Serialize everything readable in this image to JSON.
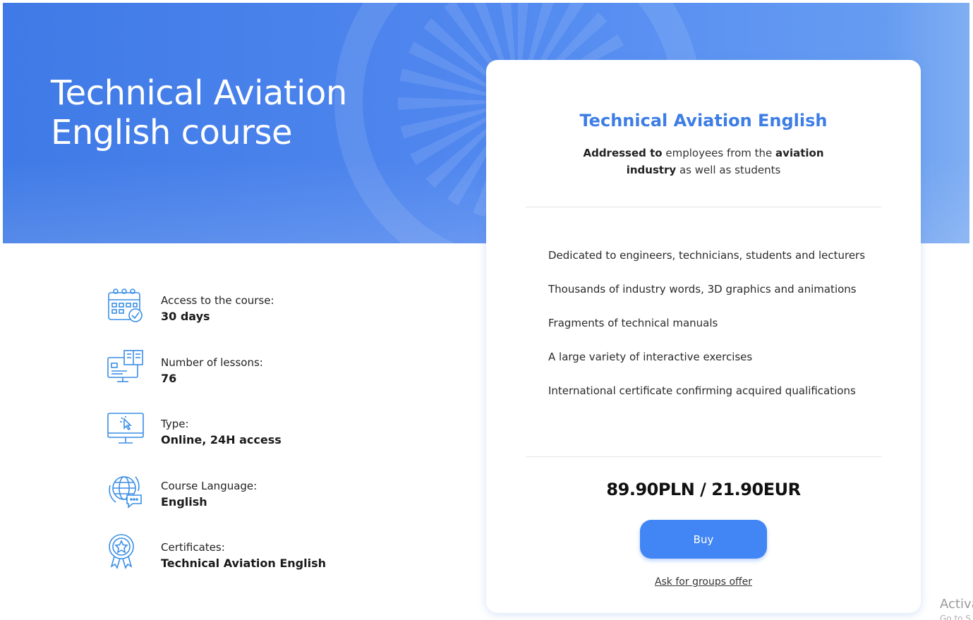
{
  "hero": {
    "title_line1": "Technical Aviation",
    "title_line2": "English course"
  },
  "features": [
    {
      "icon": "calendar-check-icon",
      "label": "Access to the course:",
      "value": "30 days"
    },
    {
      "icon": "lessons-screen-icon",
      "label": "Number of lessons:",
      "value": "76"
    },
    {
      "icon": "monitor-cursor-icon",
      "label": "Type:",
      "value": "Online, 24H access"
    },
    {
      "icon": "globe-chat-icon",
      "label": "Course Language:",
      "value": "English"
    },
    {
      "icon": "certificate-badge-icon",
      "label": "Certificates:",
      "value": "Technical Aviation English"
    }
  ],
  "card": {
    "title": "Technical Aviation English",
    "subtitle": {
      "b1": "Addressed to",
      "t1": " employees from the ",
      "b2": "aviation industry",
      "t2": " as well as students"
    },
    "benefits": [
      "Dedicated to engineers, technicians, students and lecturers",
      "Thousands of industry words, 3D graphics and animations",
      "Fragments of technical manuals",
      "A large variety of interactive exercises",
      "International certificate confirming acquired qualifications"
    ],
    "price": "89.90PLN / 21.90EUR",
    "buy_label": "Buy",
    "groups_link": "Ask for groups offer"
  },
  "watermark": {
    "line1": "Activa",
    "line2": "Go to S"
  },
  "colors": {
    "accent": "#4285f4",
    "title_blue": "#3d7de6",
    "hero_blue": "#4f86ee",
    "icon_blue": "#3a8ee6"
  }
}
